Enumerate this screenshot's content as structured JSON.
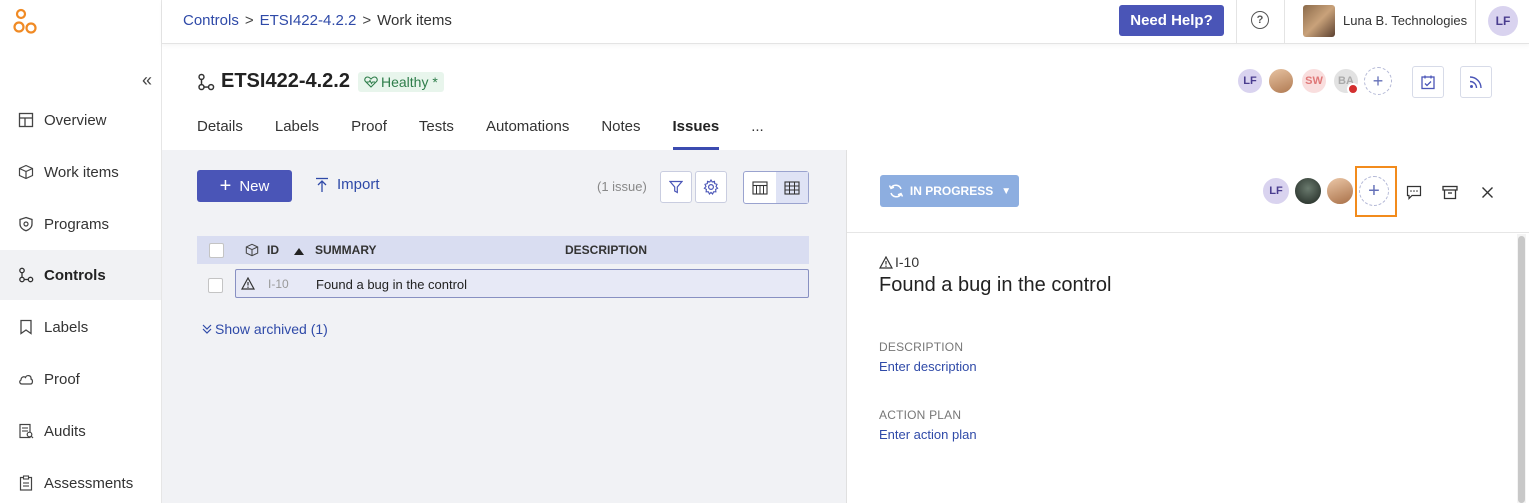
{
  "sidebar": {
    "collapse_glyph": "«",
    "items": [
      {
        "label": "Overview",
        "icon": "overview-icon",
        "active": false
      },
      {
        "label": "Work items",
        "icon": "box-icon",
        "active": false
      },
      {
        "label": "Programs",
        "icon": "shield-icon",
        "active": false
      },
      {
        "label": "Controls",
        "icon": "controls-icon",
        "active": true
      },
      {
        "label": "Labels",
        "icon": "label-icon",
        "active": false
      },
      {
        "label": "Proof",
        "icon": "cloud-icon",
        "active": false
      },
      {
        "label": "Audits",
        "icon": "audit-icon",
        "active": false
      },
      {
        "label": "Assessments",
        "icon": "clipboard-icon",
        "active": false
      }
    ]
  },
  "topbar": {
    "breadcrumb": [
      "Controls",
      "ETSI422-4.2.2",
      "Work items"
    ],
    "separator": ">",
    "help_label": "Need Help?",
    "help_glyph": "?",
    "org_name": "Luna B. Technologies",
    "user_initials": "LF"
  },
  "header": {
    "title": "ETSI422-4.2.2",
    "health": "Healthy *",
    "owners": [
      {
        "initials": "LF",
        "bg": "#d9d3ef",
        "fg": "#4a3d8f"
      },
      {
        "initials": "",
        "bg": "#e0b48e",
        "fg": "#ffffff"
      },
      {
        "initials": "SW",
        "bg": "#f9dede",
        "fg": "#e07878"
      },
      {
        "initials": "BA",
        "bg": "#e2e2e2",
        "fg": "#aaaaaa"
      }
    ],
    "add_glyph": "+"
  },
  "tabs": [
    {
      "label": "Details",
      "active": false
    },
    {
      "label": "Labels",
      "active": false
    },
    {
      "label": "Proof",
      "active": false
    },
    {
      "label": "Tests",
      "active": false
    },
    {
      "label": "Automations",
      "active": false
    },
    {
      "label": "Notes",
      "active": false
    },
    {
      "label": "Issues",
      "active": true
    },
    {
      "label": "...",
      "active": false
    }
  ],
  "issues": {
    "new_label": "New",
    "new_glyph": "+",
    "import_label": "Import",
    "count_label": "(1 issue)",
    "columns": {
      "id": "ID",
      "summary": "SUMMARY",
      "description": "DESCRIPTION"
    },
    "rows": [
      {
        "id": "I-10",
        "summary": "Found a bug in the control",
        "description": ""
      }
    ],
    "show_archived": "Show archived (1)"
  },
  "detail": {
    "status": "IN PROGRESS",
    "assignees": [
      {
        "initials": "LF",
        "bg": "#d9d3ef",
        "fg": "#4a3d8f"
      },
      {
        "initials": "",
        "bg": "#2f3b33",
        "fg": "#ffffff"
      },
      {
        "initials": "",
        "bg": "#d6a988",
        "fg": "#ffffff"
      }
    ],
    "add_glyph": "+",
    "issue_id": "I-10",
    "issue_title": "Found a bug in the control",
    "description_label": "DESCRIPTION",
    "description_placeholder": "Enter description",
    "action_plan_label": "ACTION PLAN",
    "action_plan_placeholder": "Enter action plan"
  },
  "colors": {
    "accent": "#4a55b7",
    "link": "#2f4aa8",
    "status": "#8daee0",
    "highlight": "#f28b1c",
    "healthy": "#2e7d4a"
  }
}
